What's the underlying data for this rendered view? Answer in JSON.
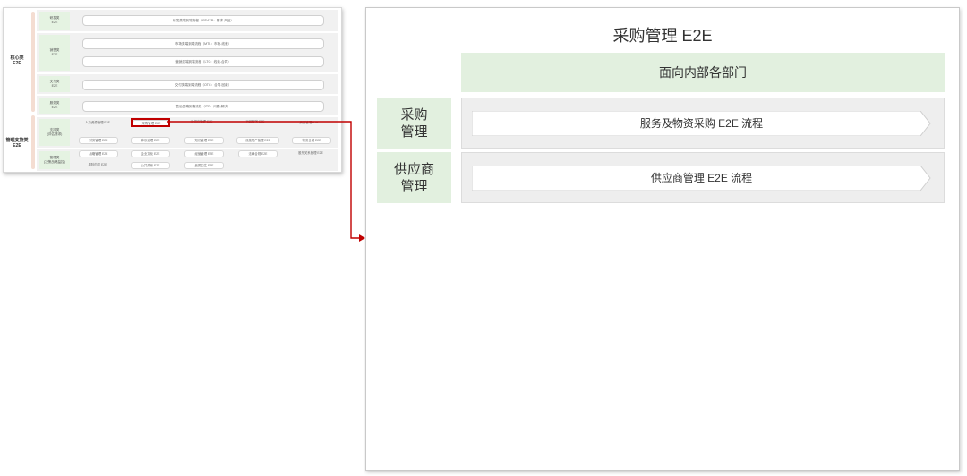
{
  "thumbnail": {
    "groups": [
      {
        "label": "核心类\nE2E"
      },
      {
        "label": "管理支持类\nE2E"
      }
    ],
    "rows": [
      {
        "tag": "研发类\nE2E",
        "pills": [
          "研发类端到端流程（IPD/ITR：需求-产品）"
        ]
      },
      {
        "tag": "销售类\nE2E",
        "pills": [
          "市场类端到端流程（MTL：市场-线索）",
          "营销类端到端流程（LTC：线索-合同）"
        ]
      },
      {
        "tag": "交付类\nE2E",
        "pills": [
          "交付类端到端流程（OTC：合同-回款）"
        ]
      },
      {
        "tag": "服务类\nE2E",
        "pills": [
          "售后类端到端流程（ITR：问题-解决）"
        ]
      }
    ],
    "support": [
      {
        "tag": "支持类\n(评估需求)",
        "items": [
          "人力资源管理 E2E",
          "采购管理 E2E",
          "IT 供应管理 E2E",
          "行政服务 E2E",
          "质量管理 E2E",
          "财务管理 E2E",
          "体系治理 E2E",
          "知识管理 E2E",
          "设施资产管理 E2E",
          "物流仓储 E2E"
        ]
      },
      {
        "tag": "管理类\n(决策战略监控)",
        "items": [
          "战略管理 E2E",
          "企业文化 E2E",
          "经营管理 E2E",
          "法律合规 E2E",
          "股东关系管理 E2E",
          "风险内控 E2E",
          "公共关系 E2E",
          "品质卫生 E2E"
        ]
      }
    ]
  },
  "panel": {
    "title": "采购管理 E2E",
    "department_header": "面向内部各部门",
    "rows": [
      {
        "tag": "采购\n管理",
        "flow": "服务及物资采购 E2E 流程"
      },
      {
        "tag": "供应商\n管理",
        "flow": "供应商管理 E2E 流程"
      }
    ]
  },
  "colors": {
    "accent_green": "#e2f0df",
    "highlight_red": "#c00000",
    "band_gray": "#eeeeee"
  }
}
